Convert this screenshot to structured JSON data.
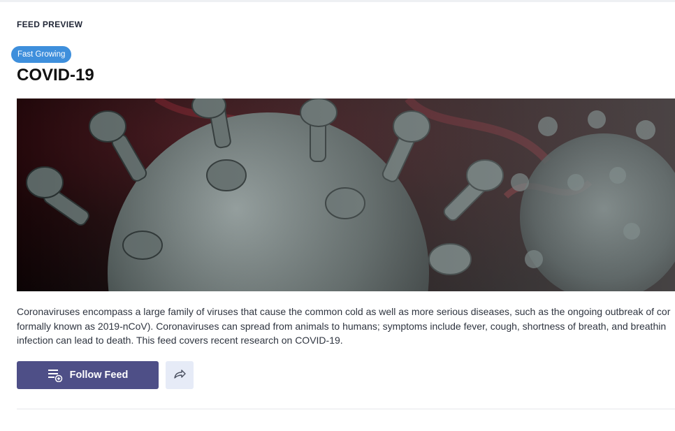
{
  "header": {
    "section_label": "FEED PREVIEW"
  },
  "feed": {
    "badge": "Fast Growing",
    "title": "COVID-19",
    "hero_image": {
      "icon": "coronavirus-image"
    },
    "description_lines": [
      "Coronaviruses encompass a large family of viruses that cause the common cold as well as more serious diseases, such as the ongoing outbreak of cor",
      "formally known as 2019-nCoV). Coronaviruses can spread from animals to humans; symptoms include fever, cough, shortness of breath, and breathin",
      "infection can lead to death. This feed covers recent research on COVID-19."
    ]
  },
  "actions": {
    "follow_label": "Follow Feed",
    "follow_icon": "feed-add-icon",
    "share_icon": "share-arrow-icon"
  },
  "colors": {
    "badge": "#3e8fdc",
    "follow_button": "#4e4f87",
    "share_button": "#e6ebf7"
  }
}
